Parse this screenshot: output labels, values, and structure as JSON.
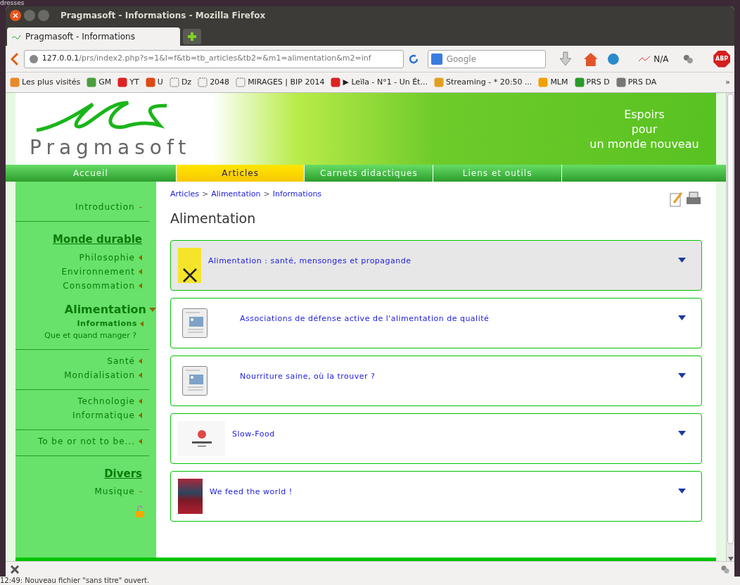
{
  "desktop": {
    "top_text": "dresses",
    "bottom_text": "12:49: Nouveau fichier \"sans titre\" ouvert."
  },
  "window": {
    "title": "Pragmasoft - Informations - Mozilla Firefox"
  },
  "browser": {
    "tabs": [
      {
        "label": "Pragmasoft - Informations",
        "selected": true
      }
    ],
    "url": {
      "host": "127.0.0.1",
      "path": "/prs/index2.php?s=1&l=f&tb=tb_articles&tb2=&m1=alimentation&m2=inf"
    },
    "search": {
      "placeholder": "Google"
    },
    "addon_label": "N/A",
    "adblock_label": "ABP",
    "bookmarks": [
      {
        "label": "Les plus visités",
        "kind": "folder"
      },
      {
        "label": "GM",
        "kind": "map"
      },
      {
        "label": "YT",
        "kind": "video"
      },
      {
        "label": "U",
        "kind": "ring"
      },
      {
        "label": "Dz",
        "kind": "blank"
      },
      {
        "label": "2048",
        "kind": "blank"
      },
      {
        "label": "MIRAGES | BIP 2014",
        "kind": "blank"
      },
      {
        "label": "▶ Leïla - N°1 - Un Ét...",
        "kind": "video"
      },
      {
        "label": "Streaming - * 20:50 ...",
        "kind": "chart"
      },
      {
        "label": "MLM",
        "kind": "badge"
      },
      {
        "label": "PRS D",
        "kind": "wave"
      },
      {
        "label": "PRS DA",
        "kind": "cloud"
      }
    ],
    "overflow": "»"
  },
  "site": {
    "logo_text": "Pragmasoft",
    "slogan": [
      "Espoirs",
      "pour",
      "un monde nouveau"
    ],
    "nav": [
      {
        "label": "Accueil",
        "selected": false
      },
      {
        "label": "Articles",
        "selected": true
      },
      {
        "label": "Carnets didactiques",
        "selected": false
      },
      {
        "label": "Liens et outils",
        "selected": false
      }
    ],
    "sidebar": [
      {
        "items": [
          {
            "label": "Introduction",
            "kind": "leaf",
            "marker": "-"
          }
        ]
      },
      {
        "items": [
          {
            "label": "Monde durable",
            "kind": "heading"
          },
          {
            "label": "Philosophie",
            "kind": "arrow"
          },
          {
            "label": "Environnement",
            "kind": "arrow"
          },
          {
            "label": "Consommation",
            "kind": "arrow"
          },
          {
            "label": "Alimentation",
            "kind": "expanded"
          },
          {
            "label": "Informations",
            "kind": "sub",
            "selected": true
          },
          {
            "label": "Que et quand manger ?",
            "kind": "sub",
            "selected": false
          }
        ]
      },
      {
        "items": [
          {
            "label": "Santé",
            "kind": "arrow"
          },
          {
            "label": "Mondialisation",
            "kind": "arrow"
          }
        ]
      },
      {
        "items": [
          {
            "label": "Technologie",
            "kind": "arrow"
          },
          {
            "label": "Informatique",
            "kind": "arrow"
          }
        ]
      },
      {
        "items": [
          {
            "label": "To be or not to be...",
            "kind": "arrow"
          }
        ]
      },
      {
        "items": [
          {
            "label": "Divers",
            "kind": "heading"
          },
          {
            "label": "Musique",
            "kind": "leaf",
            "marker": "-"
          }
        ]
      }
    ],
    "breadcrumb": [
      "Articles",
      "Alimentation",
      "Informations"
    ],
    "breadcrumb_sep": ">",
    "heading": "Alimentation",
    "articles": [
      {
        "title": "Alimentation : santé, mensonges et propagande",
        "kind": "book",
        "hovered": true
      },
      {
        "title": "Associations de défense active de l'alimentation de qualité",
        "kind": "placeholder",
        "hovered": false
      },
      {
        "title": "Nourriture saine, où la trouver ?",
        "kind": "placeholder",
        "hovered": false
      },
      {
        "title": "Slow-Food",
        "kind": "logo",
        "hovered": false
      },
      {
        "title": "We feed the world !",
        "kind": "poster",
        "hovered": false
      }
    ]
  }
}
